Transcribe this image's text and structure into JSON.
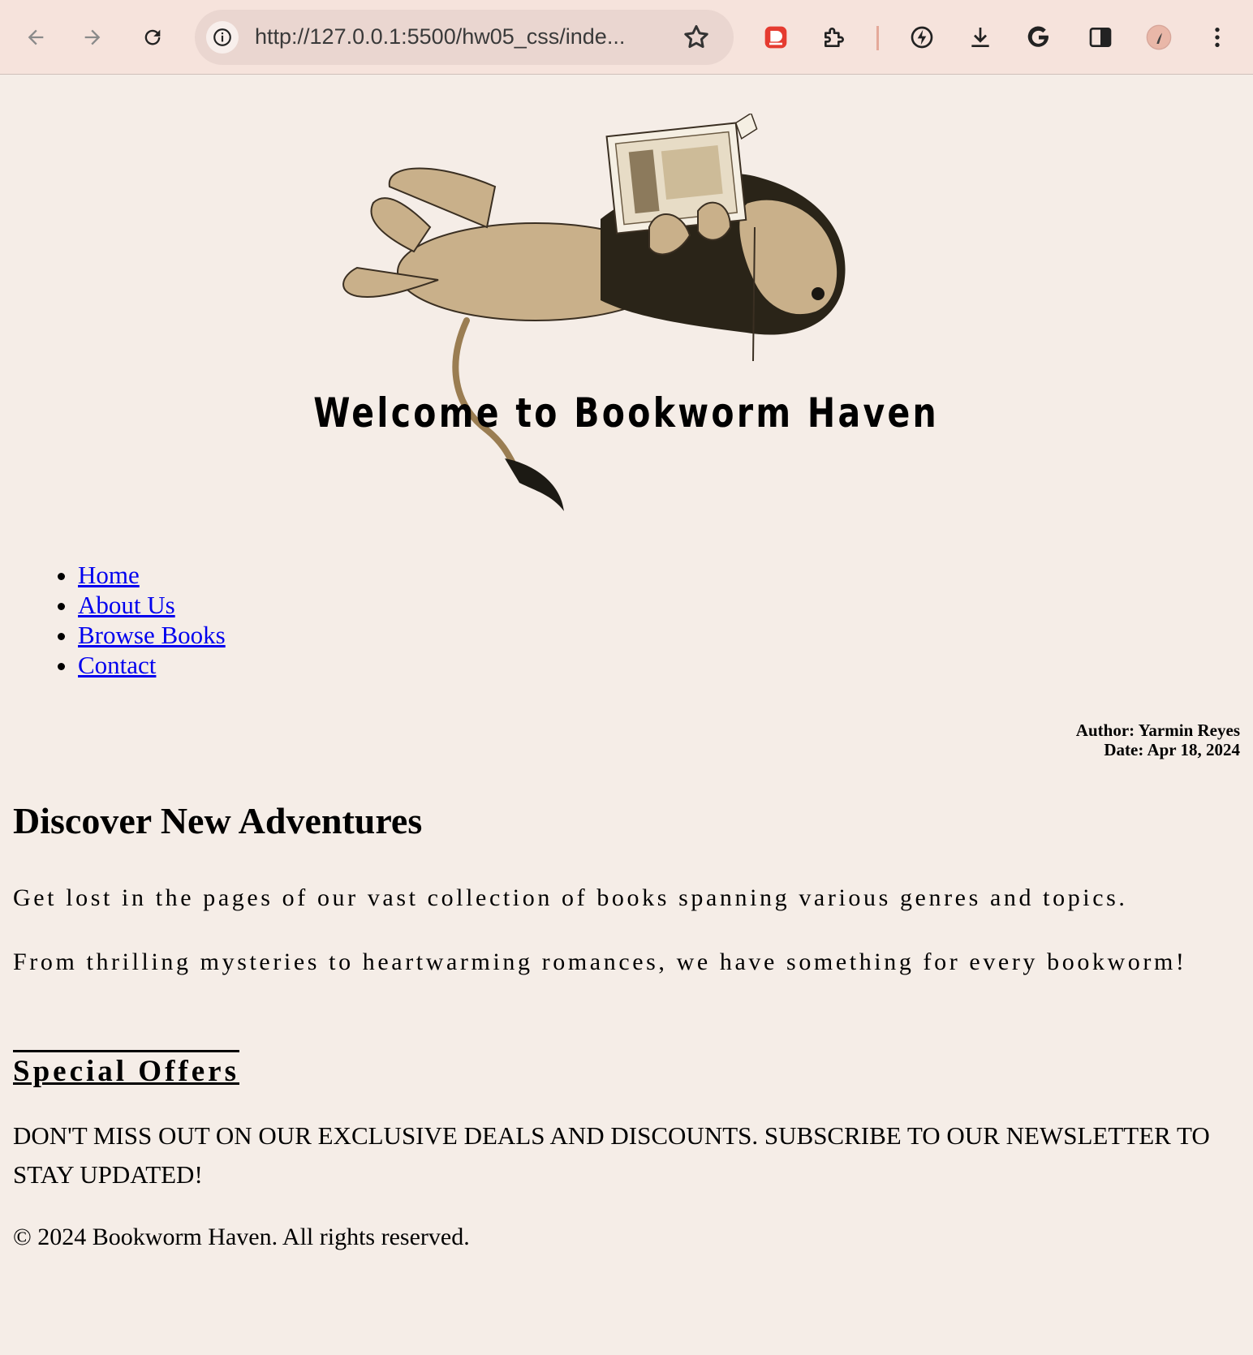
{
  "browser": {
    "url": "http://127.0.0.1:5500/hw05_css/inde...",
    "icons": [
      "back-icon",
      "forward-icon",
      "reload-icon",
      "site-info-icon",
      "bookmark-star-icon",
      "extension-red-icon",
      "puzzle-extensions-icon",
      "performance-icon",
      "download-icon",
      "google-icon",
      "side-panel-icon",
      "profile-avatar",
      "more-menu-icon"
    ]
  },
  "header": {
    "title": "Welcome to Bookworm Haven"
  },
  "nav": {
    "items": [
      {
        "label": "Home"
      },
      {
        "label": "About Us"
      },
      {
        "label": "Browse Books"
      },
      {
        "label": "Contact"
      }
    ]
  },
  "meta": {
    "author": "Author: Yarmin Reyes",
    "date": "Date: Apr 18, 2024"
  },
  "main": {
    "heading": "Discover New Adventures",
    "p1": "Get lost in the pages of our vast collection of books spanning various genres and topics.",
    "p2": "From thrilling mysteries to heartwarming romances, we have something for every bookworm!"
  },
  "offers": {
    "heading": "Special Offers",
    "text": "Don't miss out on our exclusive deals and discounts. Subscribe to our newsletter to stay updated!"
  },
  "footer": {
    "text": "© 2024 Bookworm Haven. All rights reserved."
  },
  "colors": {
    "page_bg": "#f5ede7",
    "toolbar_bg": "#f6e3dc",
    "link": "#0000ee"
  }
}
